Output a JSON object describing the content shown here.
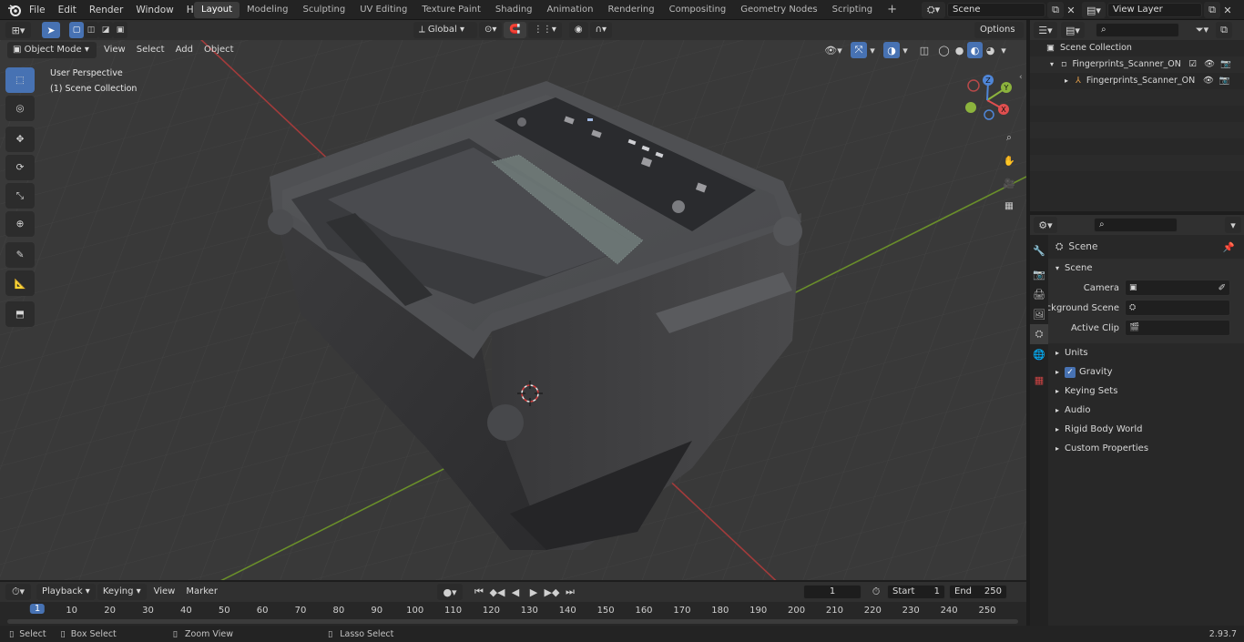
{
  "app": {
    "menus": [
      "File",
      "Edit",
      "Render",
      "Window",
      "Help"
    ],
    "workspaces": [
      "Layout",
      "Modeling",
      "Sculpting",
      "UV Editing",
      "Texture Paint",
      "Shading",
      "Animation",
      "Rendering",
      "Compositing",
      "Geometry Nodes",
      "Scripting"
    ],
    "active_workspace": "Layout",
    "scene_name": "Scene",
    "view_layer": "View Layer"
  },
  "viewport_header": {
    "mode": "Object Mode",
    "menus": [
      "View",
      "Select",
      "Add",
      "Object"
    ],
    "transform_orientation": "Global",
    "options_label": "Options"
  },
  "viewport": {
    "perspective_label": "User Perspective",
    "collection_label": "(1) Scene Collection",
    "gizmo_axes": [
      "X",
      "Y",
      "Z"
    ],
    "accent_color": "#4772b3"
  },
  "outliner": {
    "root": "Scene Collection",
    "items": [
      {
        "label": "Fingerprints_Scanner_ON",
        "type": "collection"
      },
      {
        "label": "Fingerprints_Scanner_ON",
        "type": "object"
      }
    ]
  },
  "properties": {
    "context_title": "Scene",
    "panel_title": "Scene",
    "fields": [
      {
        "label": "Camera"
      },
      {
        "label": "Background Scene"
      },
      {
        "label": "Active Clip"
      }
    ],
    "subpanels": [
      "Units",
      "Gravity",
      "Keying Sets",
      "Audio",
      "Rigid Body World",
      "Custom Properties"
    ],
    "gravity_checked": true
  },
  "timeline": {
    "menus": [
      "Playback",
      "Keying",
      "View",
      "Marker"
    ],
    "current_frame": "1",
    "start_label": "Start",
    "start_value": "1",
    "end_label": "End",
    "end_value": "250",
    "ticks": [
      "1",
      "10",
      "20",
      "30",
      "40",
      "50",
      "60",
      "70",
      "80",
      "90",
      "100",
      "110",
      "120",
      "130",
      "140",
      "150",
      "160",
      "170",
      "180",
      "190",
      "200",
      "210",
      "220",
      "230",
      "240",
      "250"
    ]
  },
  "statusbar": {
    "items": [
      "Select",
      "Box Select",
      "Zoom View",
      "Lasso Select"
    ],
    "version": "2.93.7"
  }
}
